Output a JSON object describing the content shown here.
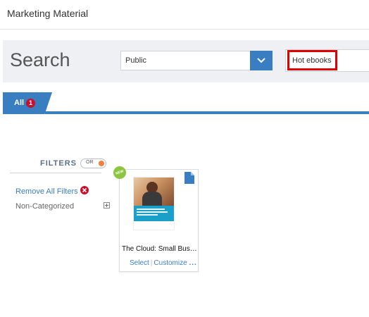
{
  "header": {
    "title": "Marketing Material"
  },
  "search": {
    "heading": "Search",
    "visibility_select": {
      "value": "Public"
    },
    "query": {
      "value": "Hot ebooks"
    }
  },
  "tabs": [
    {
      "label": "All",
      "count": "1"
    }
  ],
  "filters": {
    "title": "FILTERS",
    "toggle_label": "OR",
    "remove_all": "Remove All Filters",
    "categories": [
      {
        "label": "Non-Categorized"
      }
    ]
  },
  "results": [
    {
      "badge": "NEW",
      "title": "The Cloud: Small Business...",
      "actions": {
        "select": "Select",
        "customize": "Customize",
        "more": "..."
      }
    }
  ],
  "colors": {
    "accent": "#3a7ec2",
    "highlight": "#e00000",
    "badge": "#c8102e",
    "new_badge": "#8cc63f"
  },
  "icons": [
    "chevron-down-icon",
    "remove-icon",
    "expand-icon",
    "document-icon"
  ]
}
